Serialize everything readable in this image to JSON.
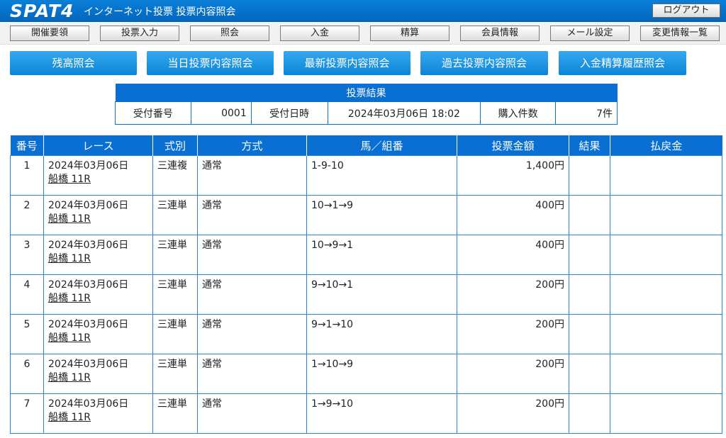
{
  "header": {
    "logo": "SPAT4",
    "title": "インターネット投票 投票内容照会",
    "logout_label": "ログアウト"
  },
  "menu": [
    {
      "label": "開催要領"
    },
    {
      "label": "投票入力"
    },
    {
      "label": "照会"
    },
    {
      "label": "入金"
    },
    {
      "label": "精算"
    },
    {
      "label": "会員情報"
    },
    {
      "label": "メール設定"
    },
    {
      "label": "変更情報一覧"
    }
  ],
  "subnav": [
    {
      "label": "残高照会"
    },
    {
      "label": "当日投票内容照会"
    },
    {
      "label": "最新投票内容照会"
    },
    {
      "label": "過去投票内容照会"
    },
    {
      "label": "入金精算履歴照会"
    }
  ],
  "summary": {
    "title": "投票結果",
    "receipt_no_label": "受付番号",
    "receipt_no": "0001",
    "receipt_date_label": "受付日時",
    "receipt_date": "2024年03月06日 18:02",
    "count_label": "購入件数",
    "count": "7件"
  },
  "table": {
    "headers": {
      "no": "番号",
      "race": "レース",
      "type": "式別",
      "method": "方式",
      "combo": "馬／組番",
      "amount": "投票金額",
      "result": "結果",
      "payout": "払戻金"
    },
    "rows": [
      {
        "no": "1",
        "date": "2024年03月06日",
        "race": "船橋 11R",
        "type": "三連複",
        "method": "通常",
        "combo": "1-9-10",
        "amount": "1,400円",
        "result": "",
        "payout": ""
      },
      {
        "no": "2",
        "date": "2024年03月06日",
        "race": "船橋 11R",
        "type": "三連単",
        "method": "通常",
        "combo": "10→1→9",
        "amount": "400円",
        "result": "",
        "payout": ""
      },
      {
        "no": "3",
        "date": "2024年03月06日",
        "race": "船橋 11R",
        "type": "三連単",
        "method": "通常",
        "combo": "10→9→1",
        "amount": "400円",
        "result": "",
        "payout": ""
      },
      {
        "no": "4",
        "date": "2024年03月06日",
        "race": "船橋 11R",
        "type": "三連単",
        "method": "通常",
        "combo": "9→10→1",
        "amount": "200円",
        "result": "",
        "payout": ""
      },
      {
        "no": "5",
        "date": "2024年03月06日",
        "race": "船橋 11R",
        "type": "三連単",
        "method": "通常",
        "combo": "9→1→10",
        "amount": "200円",
        "result": "",
        "payout": ""
      },
      {
        "no": "6",
        "date": "2024年03月06日",
        "race": "船橋 11R",
        "type": "三連単",
        "method": "通常",
        "combo": "1→10→9",
        "amount": "200円",
        "result": "",
        "payout": ""
      },
      {
        "no": "7",
        "date": "2024年03月06日",
        "race": "船橋 11R",
        "type": "三連単",
        "method": "通常",
        "combo": "1→9→10",
        "amount": "200円",
        "result": "",
        "payout": ""
      }
    ]
  },
  "colors": {
    "header_blue": "#0265bd",
    "table_header_blue": "#0a6fd2",
    "button_blue": "#1a92e0"
  }
}
